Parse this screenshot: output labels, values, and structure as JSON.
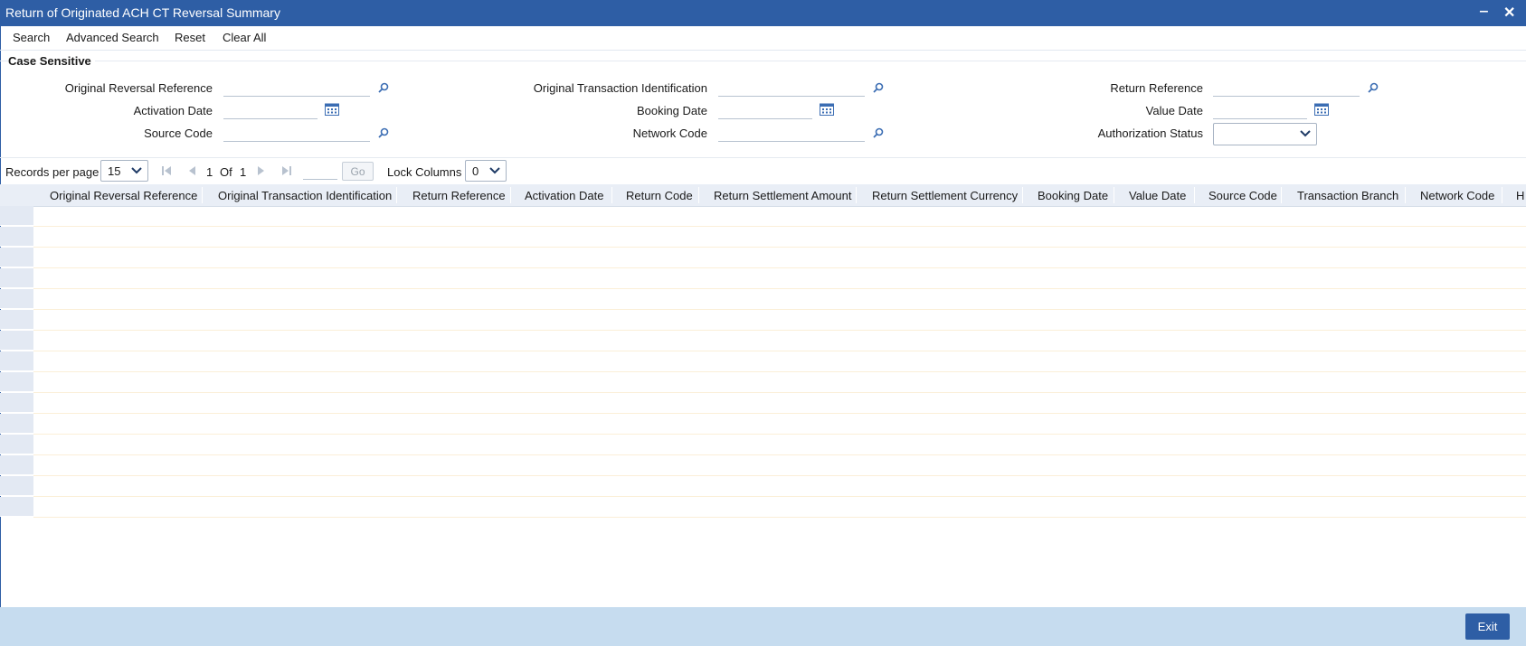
{
  "window": {
    "title": "Return of Originated ACH CT Reversal Summary",
    "minimize_glyph": "‒",
    "close_glyph": "✕"
  },
  "toolbar": {
    "search": "Search",
    "advanced_search": "Advanced Search",
    "reset": "Reset",
    "clear_all": "Clear All"
  },
  "form": {
    "section_label": "Case Sensitive",
    "original_reversal_reference": {
      "label": "Original Reversal Reference",
      "value": ""
    },
    "original_transaction_identification": {
      "label": "Original Transaction Identification",
      "value": ""
    },
    "return_reference": {
      "label": "Return Reference",
      "value": ""
    },
    "activation_date": {
      "label": "Activation Date",
      "value": ""
    },
    "booking_date": {
      "label": "Booking Date",
      "value": ""
    },
    "value_date": {
      "label": "Value Date",
      "value": ""
    },
    "source_code": {
      "label": "Source Code",
      "value": ""
    },
    "network_code": {
      "label": "Network Code",
      "value": ""
    },
    "authorization_status": {
      "label": "Authorization Status",
      "value": ""
    }
  },
  "pagination": {
    "records_label": "Records per page",
    "records_per_page": "15",
    "current_page": "1",
    "of_label": "Of",
    "total_pages": "1",
    "go_label": "Go",
    "lock_columns_label": "Lock Columns",
    "lock_columns_value": "0"
  },
  "grid": {
    "columns": [
      "Original Reversal Reference",
      "Original Transaction Identification",
      "Return Reference",
      "Activation Date",
      "Return Code",
      "Return Settlement Amount",
      "Return Settlement Currency",
      "Booking Date",
      "Value Date",
      "Source Code",
      "Transaction Branch",
      "Network Code",
      "H"
    ]
  },
  "footer": {
    "exit_label": "Exit"
  },
  "colors": {
    "titlebar": "#2e5ea5",
    "footer": "#c6dcef",
    "grid_header": "#e9eef6",
    "icon": "#3b6db3"
  }
}
